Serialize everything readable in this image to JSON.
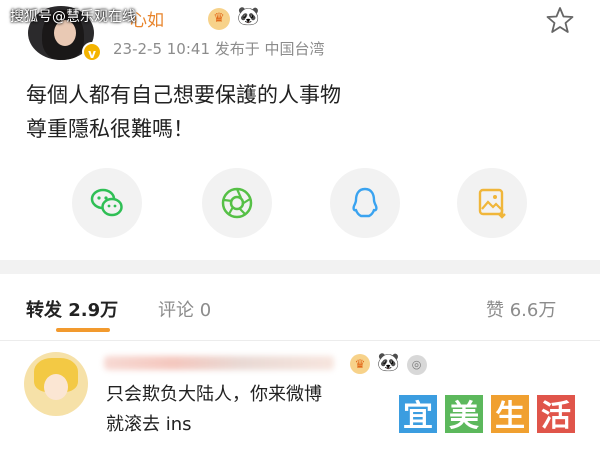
{
  "watermark": {
    "text": "搜狐号@慧乐观在线"
  },
  "post": {
    "user_name": "心如",
    "meta": "23-2-5 10:41  发布于 中国台湾",
    "lines": [
      "每個人都有自己想要保護的人事物",
      "尊重隱私很難嗎！"
    ],
    "badges": {
      "crown": "♛",
      "panda": "🐼"
    },
    "verified_mark": "v"
  },
  "share": [
    {
      "name": "wechat",
      "color": "#2fbf55"
    },
    {
      "name": "moments",
      "color": "#56c046"
    },
    {
      "name": "qq",
      "color": "#3aa3f0"
    },
    {
      "name": "save-image",
      "color": "#f0b63a"
    }
  ],
  "tabs": {
    "repost": "转发 2.9万",
    "comment": "评论 0",
    "like": "赞 6.6万"
  },
  "comment": {
    "badges": {
      "crown": "♛",
      "panda": "🐼",
      "medal": "◎"
    },
    "lines": [
      "只会欺负大陆人，你来微博",
      "就滚去 ins"
    ]
  },
  "logo_watermark": {
    "chars": [
      "宜",
      "美",
      "生",
      "活"
    ],
    "colors": [
      "#3b9de0",
      "#5cb85c",
      "#f0a030",
      "#e0554a"
    ]
  }
}
